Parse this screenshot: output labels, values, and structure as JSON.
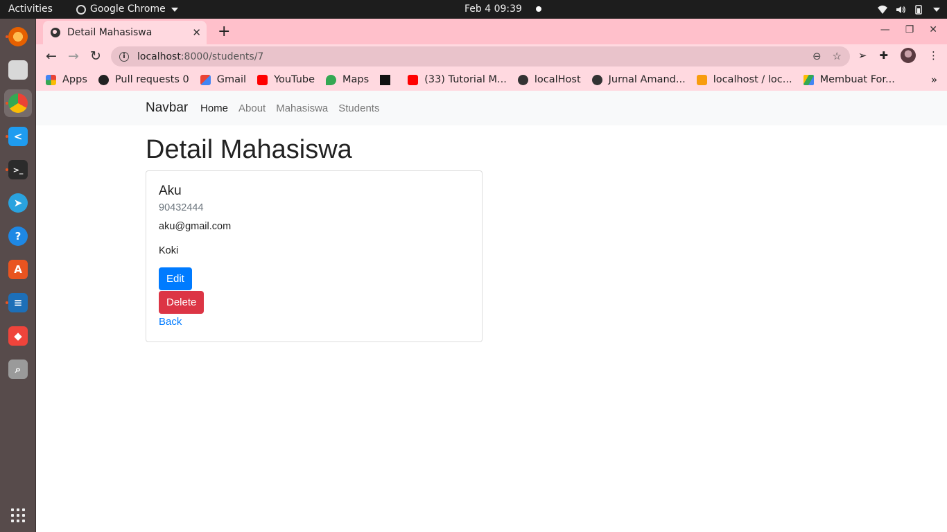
{
  "system_bar": {
    "activities": "Activities",
    "app_name": "Google Chrome",
    "clock": "Feb 4  09:39"
  },
  "dock": {
    "items": [
      {
        "name": "firefox-icon",
        "color": "#e66000"
      },
      {
        "name": "files-icon",
        "color": "#a8a8a8"
      },
      {
        "name": "chrome-icon",
        "color": "#34a853"
      },
      {
        "name": "vscode-icon",
        "color": "#1f9cf0"
      },
      {
        "name": "terminal-icon",
        "color": "#2b2b2b"
      },
      {
        "name": "telegram-icon",
        "color": "#2aa3df"
      },
      {
        "name": "help-icon",
        "color": "#1e88e5"
      },
      {
        "name": "software-icon",
        "color": "#e95420"
      },
      {
        "name": "writer-icon",
        "color": "#1d6fb8"
      },
      {
        "name": "anydesk-icon",
        "color": "#ef443b"
      },
      {
        "name": "screenshot-icon",
        "color": "#9a9a9a"
      }
    ]
  },
  "browser": {
    "tab_title": "Detail Mahasiswa",
    "url_host": "localhost",
    "url_path": ":8000/students/7",
    "bookmarks": [
      {
        "label": "Apps",
        "icon": "apps-icon",
        "color": "#4285f4"
      },
      {
        "label": "Pull requests 0",
        "icon": "github-icon",
        "color": "#222222"
      },
      {
        "label": "Gmail",
        "icon": "gmail-icon",
        "color": "#ea4335"
      },
      {
        "label": "YouTube",
        "icon": "youtube-icon",
        "color": "#ff0000"
      },
      {
        "label": "Maps",
        "icon": "maps-icon",
        "color": "#34a853"
      },
      {
        "label": "",
        "icon": "unsplash-icon",
        "color": "#111111"
      },
      {
        "label": "(33) Tutorial M...",
        "icon": "youtube-icon",
        "color": "#ff0000"
      },
      {
        "label": "localHost",
        "icon": "globe-icon",
        "color": "#333333"
      },
      {
        "label": "Jurnal Amand...",
        "icon": "globe-icon",
        "color": "#333333"
      },
      {
        "label": "localhost / loc...",
        "icon": "phpmyadmin-icon",
        "color": "#f89c0e"
      },
      {
        "label": "Membuat For...",
        "icon": "drive-icon",
        "color": "#fbbc04"
      }
    ]
  },
  "page": {
    "brand": "Navbar",
    "nav": [
      "Home",
      "About",
      "Mahasiswa",
      "Students"
    ],
    "title": "Detail Mahasiswa",
    "student": {
      "name": "Aku",
      "nrp": "90432444",
      "email": "aku@gmail.com",
      "jurusan": "Koki"
    },
    "buttons": {
      "edit": "Edit",
      "delete": "Delete",
      "back": "Back"
    }
  }
}
